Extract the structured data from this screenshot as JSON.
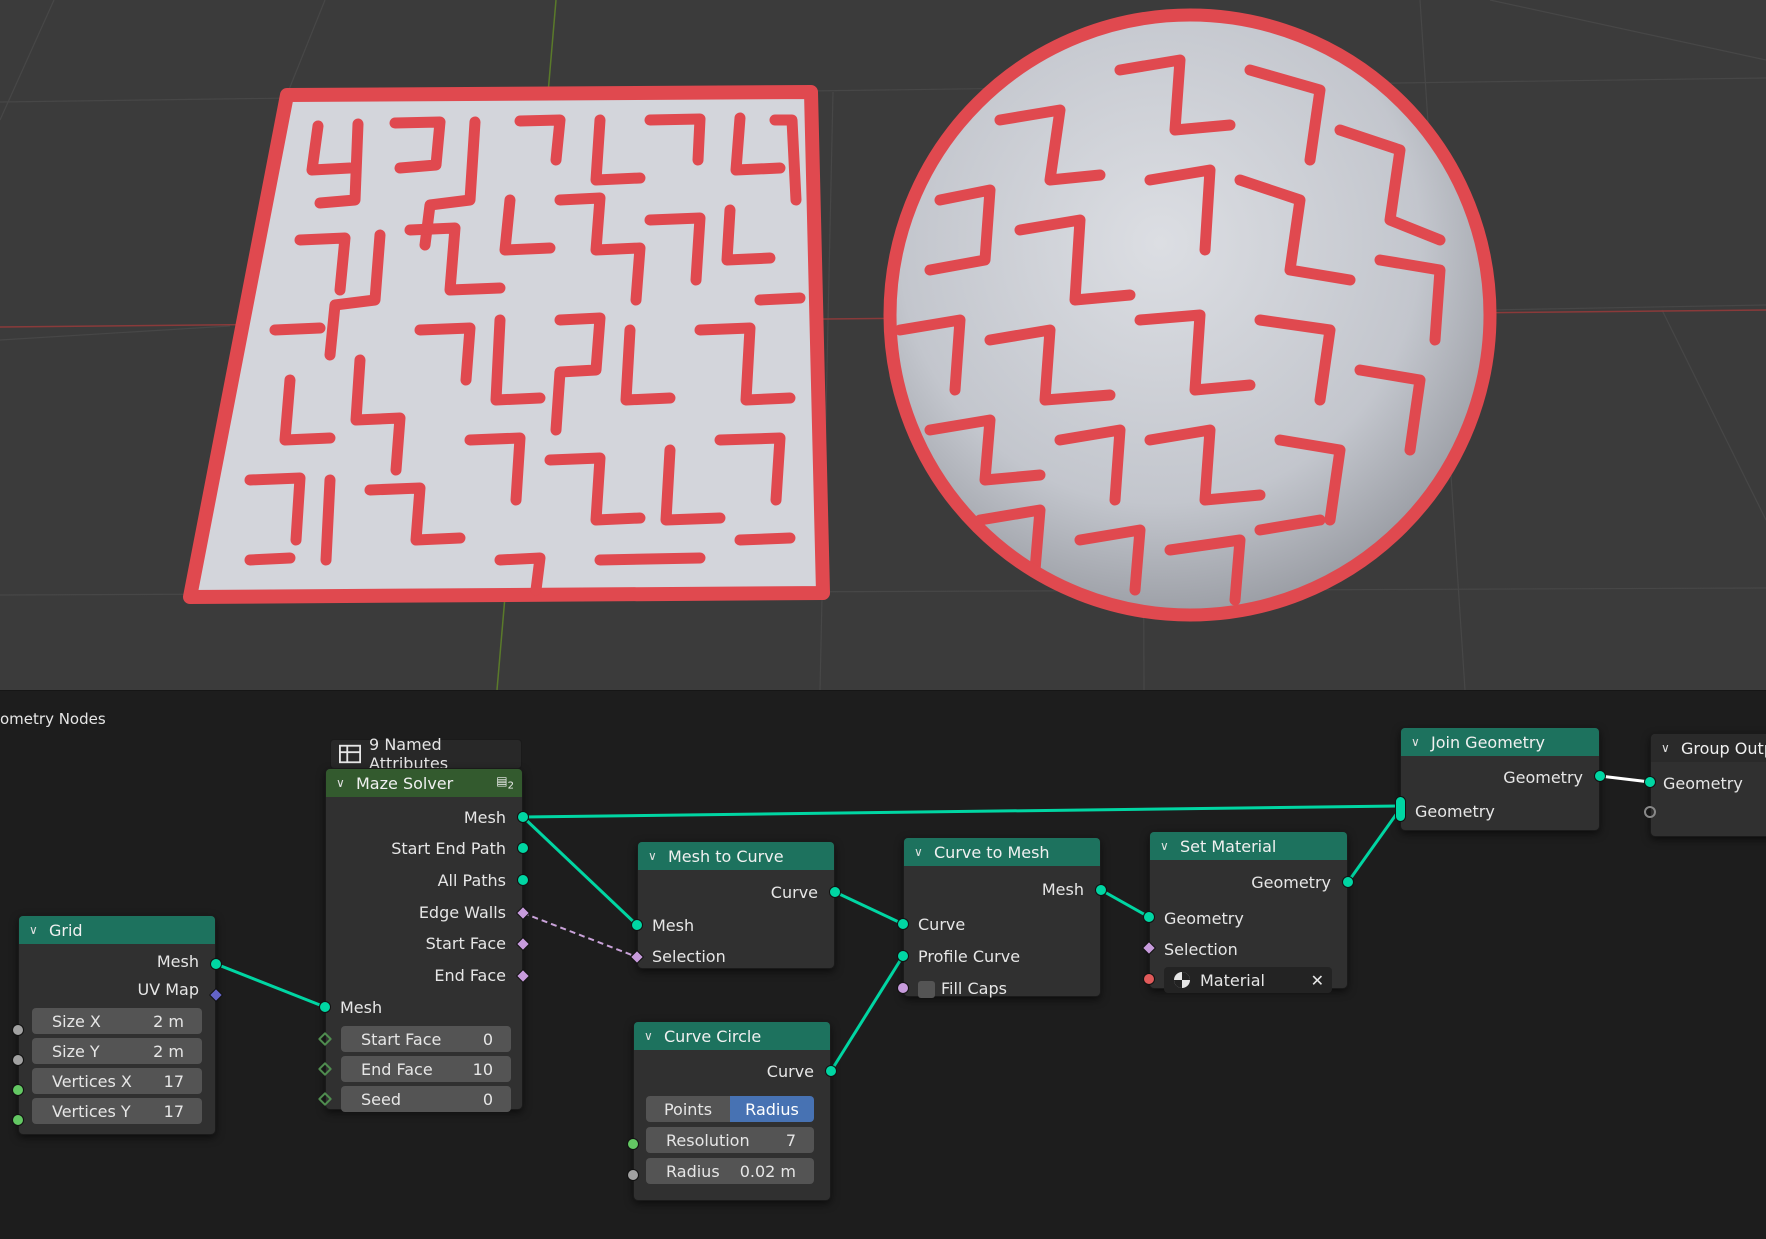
{
  "editor": {
    "label": "ometry Nodes"
  },
  "colors": {
    "wire": "#00d6a3",
    "maze_wall": "#e0494f",
    "floor": "#d3d5db",
    "header_teal": "#1d725e",
    "header_green": "#335a2e"
  },
  "nodes": {
    "grid": {
      "title": "Grid",
      "out_mesh": "Mesh",
      "out_uv": "UV Map",
      "size_x": {
        "label": "Size X",
        "value": "2 m"
      },
      "size_y": {
        "label": "Size Y",
        "value": "2 m"
      },
      "verts_x": {
        "label": "Vertices X",
        "value": "17"
      },
      "verts_y": {
        "label": "Vertices Y",
        "value": "17"
      }
    },
    "maze": {
      "attributes": "9 Named Attributes",
      "title": "Maze Solver",
      "users": "2",
      "out_mesh": "Mesh",
      "out_start_end": "Start End Path",
      "out_all_paths": "All Paths",
      "out_edge_walls": "Edge Walls",
      "out_start_face": "Start Face",
      "out_end_face": "End Face",
      "in_mesh": "Mesh",
      "start_face": {
        "label": "Start Face",
        "value": "0"
      },
      "end_face": {
        "label": "End Face",
        "value": "10"
      },
      "seed": {
        "label": "Seed",
        "value": "0"
      }
    },
    "mesh_to_curve": {
      "title": "Mesh to Curve",
      "out_curve": "Curve",
      "in_mesh": "Mesh",
      "in_selection": "Selection"
    },
    "curve_circle": {
      "title": "Curve Circle",
      "out_curve": "Curve",
      "mode_points": "Points",
      "mode_radius": "Radius",
      "resolution": {
        "label": "Resolution",
        "value": "7"
      },
      "radius": {
        "label": "Radius",
        "value": "0.02 m"
      }
    },
    "curve_to_mesh": {
      "title": "Curve to Mesh",
      "out_mesh": "Mesh",
      "in_curve": "Curve",
      "in_profile": "Profile Curve",
      "fill_caps": "Fill Caps"
    },
    "set_material": {
      "title": "Set Material",
      "out_geometry": "Geometry",
      "in_geometry": "Geometry",
      "in_selection": "Selection",
      "material": "Material"
    },
    "join": {
      "title": "Join Geometry",
      "out_geometry": "Geometry",
      "in_geometry": "Geometry"
    },
    "group_output": {
      "title": "Group Outp",
      "in_geometry": "Geometry"
    }
  }
}
